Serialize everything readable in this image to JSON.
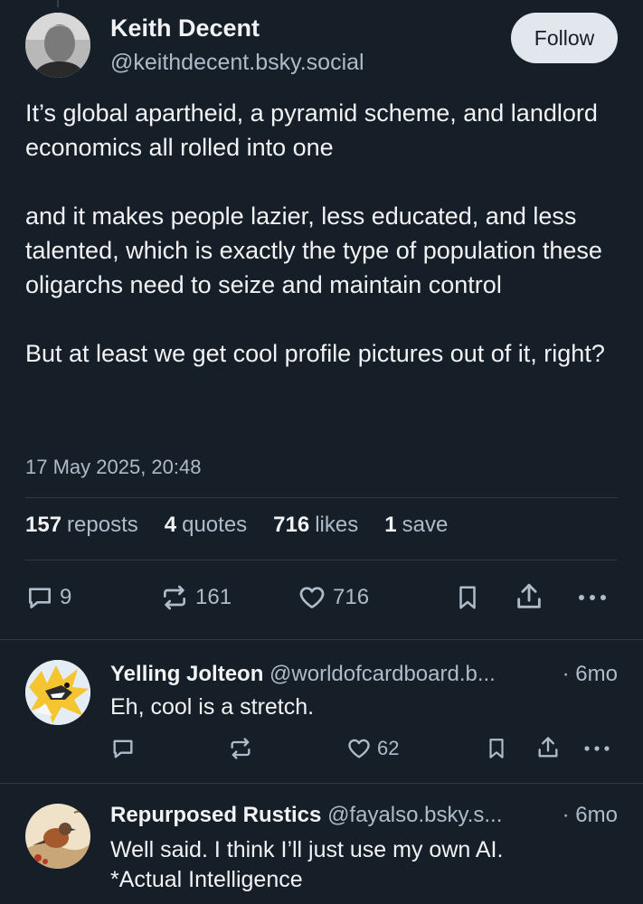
{
  "post": {
    "author_name": "Keith Decent",
    "author_handle": "@keithdecent.bsky.social",
    "follow_label": "Follow",
    "paragraphs": [
      "It’s global apartheid, a pyramid scheme, and landlord economics all rolled into one",
      "and it makes people lazier, less educated, and less talented, which is exactly the type of population these oligarchs need to seize and maintain control",
      "But at least we get cool profile pictures out of it, right?"
    ],
    "timestamp": "17 May 2025, 20:48",
    "stats": {
      "reposts_count": "157",
      "reposts_label": "reposts",
      "quotes_count": "4",
      "quotes_label": "quotes",
      "likes_count": "716",
      "likes_label": "likes",
      "saves_count": "1",
      "saves_label": "save"
    },
    "actions": {
      "replies": "9",
      "reposts": "161",
      "likes": "716"
    }
  },
  "replies": [
    {
      "name": "Yelling Jolteon",
      "handle": "@worldofcardboard.b...",
      "time": "· 6mo",
      "text": "Eh, cool is a stretch.",
      "likes": "62"
    },
    {
      "name": "Repurposed Rustics",
      "handle": "@fayalso.bsky.s...",
      "time": "· 6mo",
      "text_lines": [
        "Well said. I think I’ll just use my own AI.",
        "*Actual Intelligence"
      ]
    }
  ],
  "icons": [
    "reply-icon",
    "repost-icon",
    "like-icon",
    "bookmark-icon",
    "share-icon",
    "more-icon"
  ],
  "colors": {
    "background": "#161e27",
    "text": "#f1f3f5",
    "muted": "#aebbc9",
    "follow_bg": "#e2e7ee"
  }
}
